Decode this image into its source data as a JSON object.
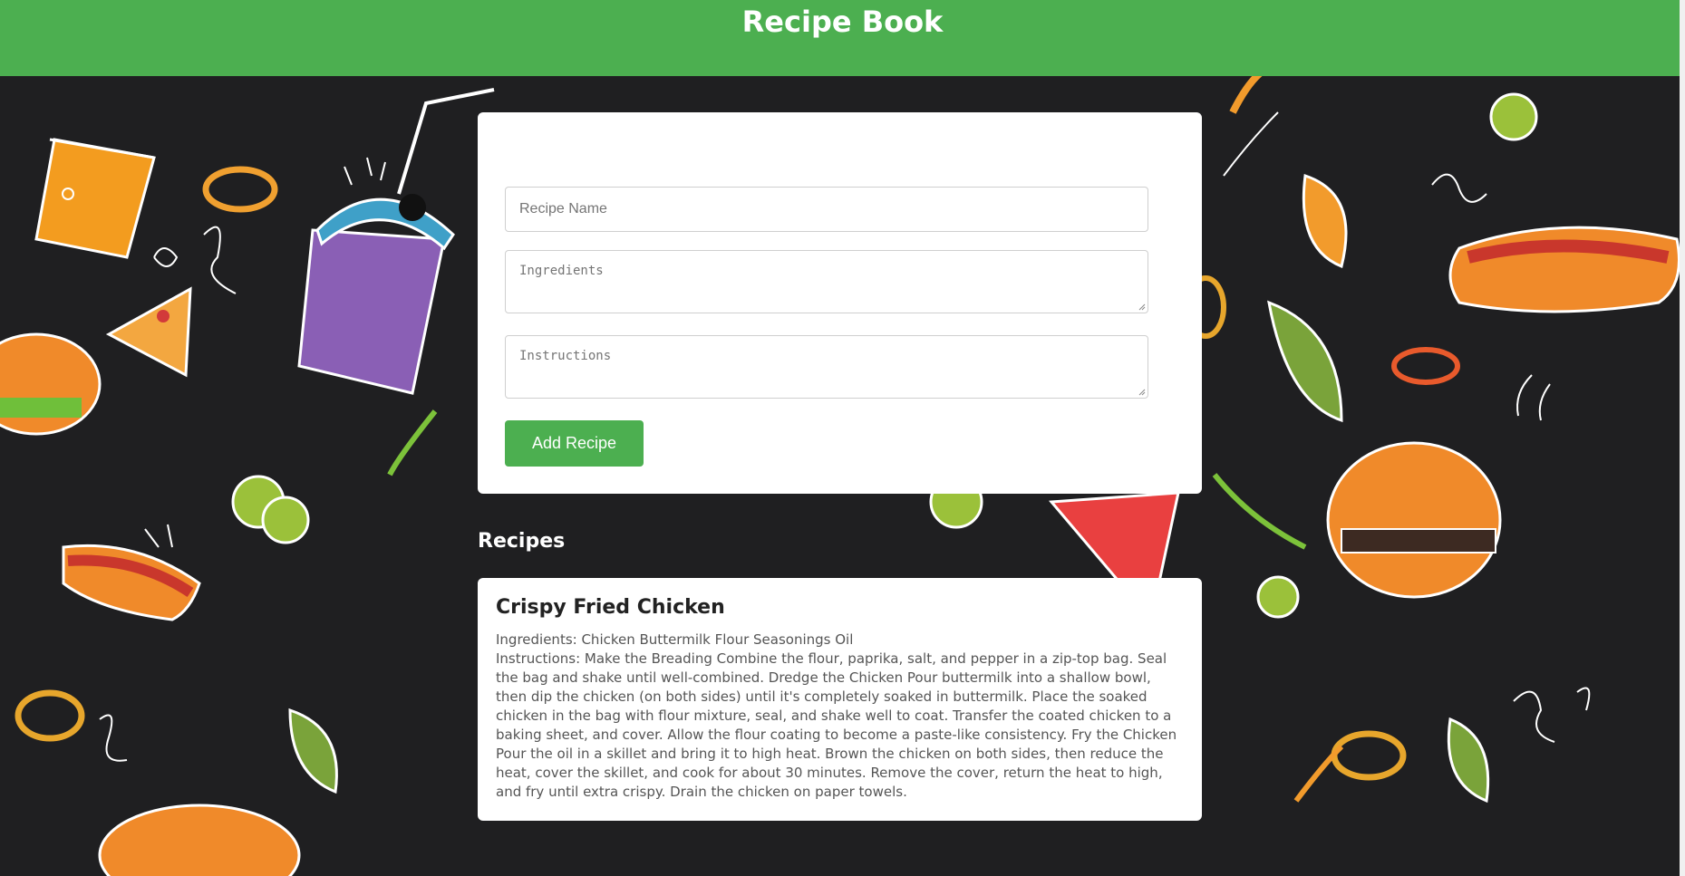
{
  "header": {
    "title": "Recipe Book"
  },
  "form": {
    "name_placeholder": "Recipe Name",
    "ingredients_placeholder": "Ingredients",
    "instructions_placeholder": "Instructions",
    "add_button_label": "Add Recipe"
  },
  "recipes": {
    "title": "Recipes",
    "items": [
      {
        "name": "Crispy Fried Chicken",
        "ingredients": "Ingredients: Chicken Buttermilk Flour Seasonings Oil",
        "instructions": "Instructions: Make the Breading Combine the flour, paprika, salt, and pepper in a zip-top bag. Seal the bag and shake until well-combined. Dredge the Chicken Pour buttermilk into a shallow bowl, then dip the chicken (on both sides) until it's completely soaked in buttermilk. Place the soaked chicken in the bag with flour mixture, seal, and shake well to coat. Transfer the coated chicken to a baking sheet, and cover. Allow the flour coating to become a paste-like consistency. Fry the Chicken Pour the oil in a skillet and bring it to high heat. Brown the chicken on both sides, then reduce the heat, cover the skillet, and cook for about 30 minutes. Remove the cover, return the heat to high, and fry until extra crispy. Drain the chicken on paper towels."
      }
    ]
  },
  "colors": {
    "header": "#4caf50",
    "button": "#4caf50",
    "background": "#1f1f21"
  },
  "icons": [
    "drink-icon",
    "burger-icon",
    "hotdog-icon",
    "pizza-icon",
    "onion-ring-icon",
    "leaf-icon",
    "broccoli-icon"
  ]
}
